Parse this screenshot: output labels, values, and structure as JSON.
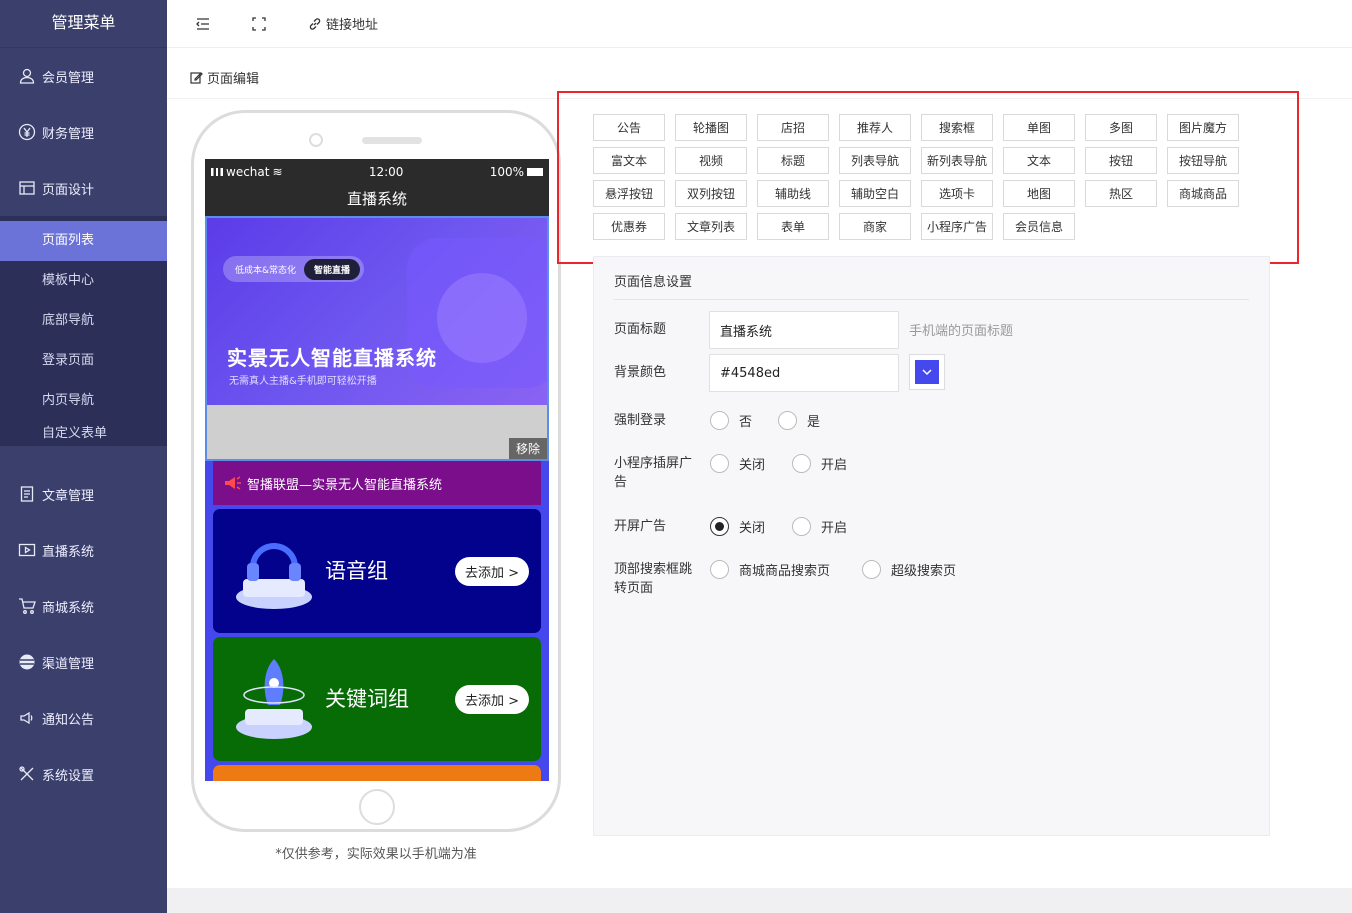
{
  "sidebar": {
    "title": "管理菜单",
    "items": [
      {
        "label": "会员管理",
        "icon": "user-icon"
      },
      {
        "label": "财务管理",
        "icon": "yen-icon"
      },
      {
        "label": "页面设计",
        "icon": "layout-icon"
      },
      {
        "label": "文章管理",
        "icon": "document-icon"
      },
      {
        "label": "直播系统",
        "icon": "video-icon"
      },
      {
        "label": "商城系统",
        "icon": "cart-icon"
      },
      {
        "label": "渠道管理",
        "icon": "layers-icon"
      },
      {
        "label": "通知公告",
        "icon": "megaphone-icon"
      },
      {
        "label": "系统设置",
        "icon": "tools-icon"
      }
    ],
    "sub_items": [
      "页面列表",
      "模板中心",
      "底部导航",
      "登录页面",
      "内页导航",
      "自定义表单"
    ]
  },
  "topbar": {
    "link_label": "链接地址"
  },
  "breadcrumb": "页面编辑",
  "phone": {
    "carrier": "wechat",
    "time": "12:00",
    "battery": "100%",
    "page_title": "直播系统",
    "banner_tag": "低成本&常态化",
    "banner_tag_badge": "智能直播",
    "banner_title": "实景无人智能直播系统",
    "banner_subtitle": "无需真人主播&手机即可轻松开播",
    "remove_label": "移除",
    "notice_text": "智播联盟—实景无人智能直播系统",
    "card1_title": "语音组",
    "card2_title": "关键词组",
    "add_label": "去添加 >",
    "note": "*仅供参考，实际效果以手机端为准"
  },
  "palette": [
    "公告",
    "轮播图",
    "店招",
    "推荐人",
    "搜索框",
    "单图",
    "多图",
    "图片魔方",
    "富文本",
    "视频",
    "标题",
    "列表导航",
    "新列表导航",
    "文本",
    "按钮",
    "按钮导航",
    "悬浮按钮",
    "双列按钮",
    "辅助线",
    "辅助空白",
    "选项卡",
    "地图",
    "热区",
    "商城商品",
    "优惠券",
    "文章列表",
    "表单",
    "商家",
    "小程序广告",
    "会员信息"
  ],
  "settings": {
    "section_title": "页面信息设置",
    "page_title_label": "页面标题",
    "page_title_value": "直播系统",
    "page_title_hint": "手机端的页面标题",
    "bg_color_label": "背景颜色",
    "bg_color_value": "#4548ed",
    "force_login_label": "强制登录",
    "force_login_options": [
      "否",
      "是"
    ],
    "mini_ad_label": "小程序插屏广告",
    "mini_ad_options": [
      "关闭",
      "开启"
    ],
    "splash_ad_label": "开屏广告",
    "splash_ad_options": [
      "关闭",
      "开启"
    ],
    "splash_ad_selected": "关闭",
    "search_jump_label": "顶部搜索框跳转页面",
    "search_jump_options": [
      "商城商品搜索页",
      "超级搜索页"
    ]
  },
  "colors": {
    "sidebar": "#3a3f6b",
    "accent": "#6b73d9",
    "page_bg": "#4548ed",
    "highlight": "#e8282d"
  }
}
